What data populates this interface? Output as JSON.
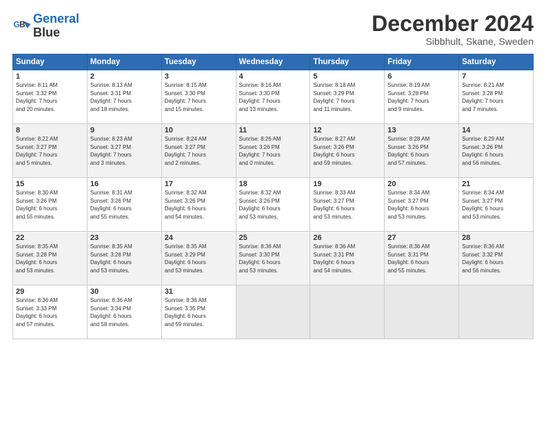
{
  "header": {
    "logo_line1": "General",
    "logo_line2": "Blue",
    "month": "December 2024",
    "location": "Sibbhult, Skane, Sweden"
  },
  "days_of_week": [
    "Sunday",
    "Monday",
    "Tuesday",
    "Wednesday",
    "Thursday",
    "Friday",
    "Saturday"
  ],
  "weeks": [
    [
      {
        "num": "1",
        "rise": "8:11 AM",
        "set": "3:32 PM",
        "daylight": "7 hours and 20 minutes."
      },
      {
        "num": "2",
        "rise": "8:13 AM",
        "set": "3:31 PM",
        "daylight": "7 hours and 18 minutes."
      },
      {
        "num": "3",
        "rise": "8:15 AM",
        "set": "3:30 PM",
        "daylight": "7 hours and 15 minutes."
      },
      {
        "num": "4",
        "rise": "8:16 AM",
        "set": "3:30 PM",
        "daylight": "7 hours and 13 minutes."
      },
      {
        "num": "5",
        "rise": "8:18 AM",
        "set": "3:29 PM",
        "daylight": "7 hours and 11 minutes."
      },
      {
        "num": "6",
        "rise": "8:19 AM",
        "set": "3:28 PM",
        "daylight": "7 hours and 9 minutes."
      },
      {
        "num": "7",
        "rise": "8:21 AM",
        "set": "3:28 PM",
        "daylight": "7 hours and 7 minutes."
      }
    ],
    [
      {
        "num": "8",
        "rise": "8:22 AM",
        "set": "3:27 PM",
        "daylight": "7 hours and 5 minutes."
      },
      {
        "num": "9",
        "rise": "8:23 AM",
        "set": "3:27 PM",
        "daylight": "7 hours and 3 minutes."
      },
      {
        "num": "10",
        "rise": "8:24 AM",
        "set": "3:27 PM",
        "daylight": "7 hours and 2 minutes."
      },
      {
        "num": "11",
        "rise": "8:26 AM",
        "set": "3:26 PM",
        "daylight": "7 hours and 0 minutes."
      },
      {
        "num": "12",
        "rise": "8:27 AM",
        "set": "3:26 PM",
        "daylight": "6 hours and 59 minutes."
      },
      {
        "num": "13",
        "rise": "8:28 AM",
        "set": "3:26 PM",
        "daylight": "6 hours and 57 minutes."
      },
      {
        "num": "14",
        "rise": "8:29 AM",
        "set": "3:26 PM",
        "daylight": "6 hours and 56 minutes."
      }
    ],
    [
      {
        "num": "15",
        "rise": "8:30 AM",
        "set": "3:26 PM",
        "daylight": "6 hours and 55 minutes."
      },
      {
        "num": "16",
        "rise": "8:31 AM",
        "set": "3:26 PM",
        "daylight": "6 hours and 55 minutes."
      },
      {
        "num": "17",
        "rise": "8:32 AM",
        "set": "3:26 PM",
        "daylight": "6 hours and 54 minutes."
      },
      {
        "num": "18",
        "rise": "8:32 AM",
        "set": "3:26 PM",
        "daylight": "6 hours and 53 minutes."
      },
      {
        "num": "19",
        "rise": "8:33 AM",
        "set": "3:27 PM",
        "daylight": "6 hours and 53 minutes."
      },
      {
        "num": "20",
        "rise": "8:34 AM",
        "set": "3:27 PM",
        "daylight": "6 hours and 53 minutes."
      },
      {
        "num": "21",
        "rise": "8:34 AM",
        "set": "3:27 PM",
        "daylight": "6 hours and 53 minutes."
      }
    ],
    [
      {
        "num": "22",
        "rise": "8:35 AM",
        "set": "3:28 PM",
        "daylight": "6 hours and 53 minutes."
      },
      {
        "num": "23",
        "rise": "8:35 AM",
        "set": "3:28 PM",
        "daylight": "6 hours and 53 minutes."
      },
      {
        "num": "24",
        "rise": "8:35 AM",
        "set": "3:29 PM",
        "daylight": "6 hours and 53 minutes."
      },
      {
        "num": "25",
        "rise": "8:36 AM",
        "set": "3:30 PM",
        "daylight": "6 hours and 53 minutes."
      },
      {
        "num": "26",
        "rise": "8:36 AM",
        "set": "3:31 PM",
        "daylight": "6 hours and 54 minutes."
      },
      {
        "num": "27",
        "rise": "8:36 AM",
        "set": "3:31 PM",
        "daylight": "6 hours and 55 minutes."
      },
      {
        "num": "28",
        "rise": "8:36 AM",
        "set": "3:32 PM",
        "daylight": "6 hours and 56 minutes."
      }
    ],
    [
      {
        "num": "29",
        "rise": "8:36 AM",
        "set": "3:33 PM",
        "daylight": "6 hours and 57 minutes."
      },
      {
        "num": "30",
        "rise": "8:36 AM",
        "set": "3:34 PM",
        "daylight": "6 hours and 58 minutes."
      },
      {
        "num": "31",
        "rise": "8:36 AM",
        "set": "3:35 PM",
        "daylight": "6 hours and 59 minutes."
      },
      null,
      null,
      null,
      null
    ]
  ]
}
